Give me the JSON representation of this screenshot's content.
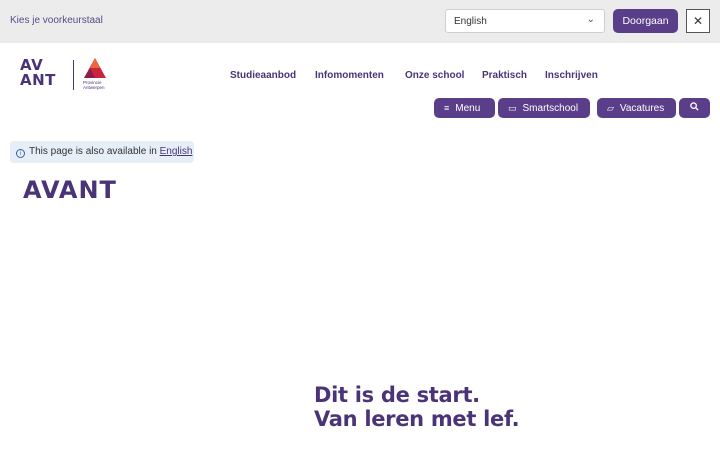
{
  "language_bar": {
    "prompt": "Kies je voorkeurstaal",
    "selected_language": "English",
    "continue_label": "Doorgaan",
    "close_icon": "close-icon"
  },
  "logo": {
    "wordmark_top": "AV",
    "wordmark_bottom": "ANT",
    "province_line1": "Provincie",
    "province_line2": "Antwerpen"
  },
  "nav": {
    "items": [
      "Studieaanbod",
      "Infomomenten",
      "Onze school",
      "Praktisch",
      "Inschrijven"
    ]
  },
  "actions": {
    "menu": "Menu",
    "smartschool": "Smartschool",
    "vacatures": "Vacatures",
    "search_icon": "search-icon"
  },
  "notice": {
    "text": "This page is also available in",
    "link": "English"
  },
  "brand_title": "AVANT",
  "hero": {
    "line1": "Dit is de start.",
    "line2": "Van leren met lef."
  },
  "colors": {
    "primary": "#5b3e8a",
    "text_purple": "#4a3477",
    "langbar_bg": "#ececec",
    "notice_bg": "#e6eef8",
    "logo_red": "#c8263f"
  }
}
